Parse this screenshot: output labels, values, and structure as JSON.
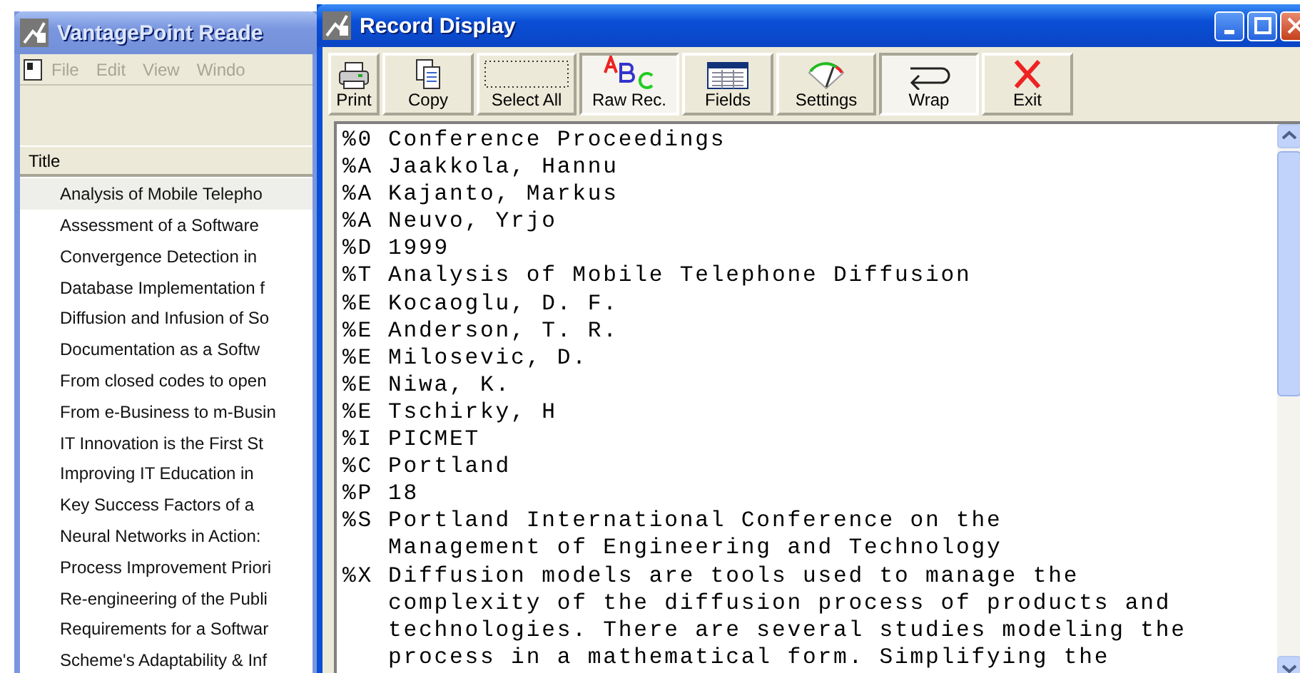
{
  "main_window": {
    "title": "VantagePoint Reade",
    "menu": [
      "File",
      "Edit",
      "View",
      "Windo"
    ],
    "table": {
      "columns": [
        "Title"
      ],
      "rows": [
        {
          "title": "Analysis of Mobile Telepho",
          "selected": true
        },
        {
          "title": "Assessment of a Software",
          "selected": false
        },
        {
          "title": "Convergence Detection in",
          "selected": false
        },
        {
          "title": "Database Implementation f",
          "selected": false
        },
        {
          "title": "Diffusion and Infusion of So",
          "selected": false
        },
        {
          "title": "Documentation as a Softw",
          "selected": false
        },
        {
          "title": "From closed codes to open",
          "selected": false
        },
        {
          "title": "From e-Business to m-Busin",
          "selected": false
        },
        {
          "title": "IT Innovation is the First St",
          "selected": false
        },
        {
          "title": "Improving IT Education in",
          "selected": false
        },
        {
          "title": "Key Success Factors of a",
          "selected": false
        },
        {
          "title": "Neural Networks in Action:",
          "selected": false
        },
        {
          "title": "Process Improvement Priori",
          "selected": false
        },
        {
          "title": "Re-engineering of the Publi",
          "selected": false
        },
        {
          "title": "Requirements for a Softwar",
          "selected": false
        },
        {
          "title": "Scheme's Adaptability & Inf",
          "selected": false
        }
      ]
    }
  },
  "record_window": {
    "title": "Record Display",
    "toolbar": [
      {
        "kind": "print",
        "label": "Print",
        "pressed": false
      },
      {
        "kind": "copy",
        "label": "Copy",
        "pressed": false
      },
      {
        "kind": "selectall",
        "label": "Select All",
        "pressed": false
      },
      {
        "kind": "raw",
        "label": "Raw Rec.",
        "pressed": true
      },
      {
        "kind": "fields",
        "label": "Fields",
        "pressed": false
      },
      {
        "kind": "settings",
        "label": "Settings",
        "pressed": false
      },
      {
        "kind": "wrap",
        "label": "Wrap",
        "pressed": true
      },
      {
        "kind": "exit",
        "label": "Exit",
        "pressed": false
      }
    ],
    "fields": [
      {
        "tag": "%0",
        "lines": [
          "Conference Proceedings"
        ]
      },
      {
        "tag": "%A",
        "lines": [
          "Jaakkola, Hannu"
        ]
      },
      {
        "tag": "%A",
        "lines": [
          "Kajanto, Markus"
        ]
      },
      {
        "tag": "%A",
        "lines": [
          "Neuvo, Yrjo"
        ]
      },
      {
        "tag": "%D",
        "lines": [
          "1999"
        ]
      },
      {
        "tag": "%T",
        "lines": [
          "Analysis of Mobile Telephone Diffusion"
        ]
      },
      {
        "tag": "%E",
        "lines": [
          "Kocaoglu, D. F."
        ]
      },
      {
        "tag": "%E",
        "lines": [
          "Anderson, T. R."
        ]
      },
      {
        "tag": "%E",
        "lines": [
          "Milosevic, D."
        ]
      },
      {
        "tag": "%E",
        "lines": [
          "Niwa, K."
        ]
      },
      {
        "tag": "%E",
        "lines": [
          "Tschirky, H"
        ]
      },
      {
        "tag": "%I",
        "lines": [
          "PICMET"
        ]
      },
      {
        "tag": "%C",
        "lines": [
          "Portland"
        ]
      },
      {
        "tag": "%P",
        "lines": [
          "18"
        ]
      },
      {
        "tag": "%S",
        "lines": [
          "Portland International Conference on the",
          "Management of Engineering and Technology"
        ]
      },
      {
        "tag": "%X",
        "lines": [
          "Diffusion models are tools used to manage the",
          "complexity of the diffusion process of products and",
          "technologies. There are several studies modeling the",
          "process in a mathematical form. Simplifying the"
        ]
      }
    ]
  }
}
